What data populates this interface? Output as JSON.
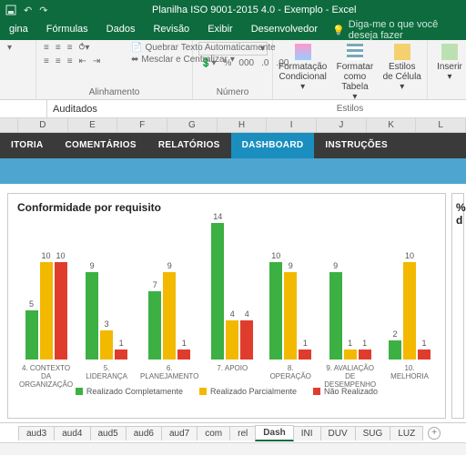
{
  "titlebar": {
    "title": "Planilha ISO 9001-2015 4.0 - Exemplo - Excel"
  },
  "ribbon_tabs": [
    "gina",
    "Fórmulas",
    "Dados",
    "Revisão",
    "Exibir",
    "Desenvolvedor"
  ],
  "tellme": "Diga-me o que você deseja fazer",
  "ribbon": {
    "wrap": "Quebrar Texto Automaticamente",
    "merge": "Mesclar e Centralizar",
    "align_group": "Alinhamento",
    "num_group": "Número",
    "styles_group": "Estilos",
    "cond": "Formatação Condicional",
    "table": "Formatar como Tabela",
    "cell": "Estilos de Célula",
    "insert": "Inserir"
  },
  "formula_value": "Auditados",
  "columns": [
    "D",
    "E",
    "F",
    "G",
    "H",
    "I",
    "J",
    "K",
    "L"
  ],
  "nav": [
    {
      "label": "ITORIA"
    },
    {
      "label": "COMENTÁRIOS"
    },
    {
      "label": "RELATÓRIOS"
    },
    {
      "label": "DASHBOARD",
      "active": true
    },
    {
      "label": "INSTRUÇÕES"
    }
  ],
  "chart_title": "Conformidade por requisito",
  "side_title": "% d",
  "chart_data": {
    "type": "bar",
    "ylim": [
      0,
      14
    ],
    "series": [
      {
        "name": "Realizado Completamente",
        "color": "#3cb043"
      },
      {
        "name": "Realizado Parcialmente",
        "color": "#f2b900"
      },
      {
        "name": "Não Realizado",
        "color": "#e03c2d"
      }
    ],
    "categories": [
      {
        "label": "4. CONTEXTO DA ORGANIZAÇÃO",
        "values": [
          5,
          10,
          10
        ]
      },
      {
        "label": "5. LIDERANÇA",
        "values": [
          9,
          3,
          1
        ]
      },
      {
        "label": "6. PLANEJAMENTO",
        "values": [
          7,
          9,
          1
        ]
      },
      {
        "label": "7. APOIO",
        "values": [
          14,
          4,
          4
        ]
      },
      {
        "label": "8. OPERAÇÃO",
        "values": [
          10,
          9,
          1
        ]
      },
      {
        "label": "9. AVALIAÇÃO DE DESEMPENHO",
        "values": [
          9,
          1,
          1
        ]
      },
      {
        "label": "10. MELHORIA",
        "values": [
          2,
          10,
          1
        ]
      }
    ]
  },
  "sheets": [
    "aud3",
    "aud4",
    "aud5",
    "aud6",
    "aud7",
    "com",
    "rel",
    "Dash",
    "INI",
    "DUV",
    "SUG",
    "LUZ"
  ],
  "active_sheet": "Dash"
}
